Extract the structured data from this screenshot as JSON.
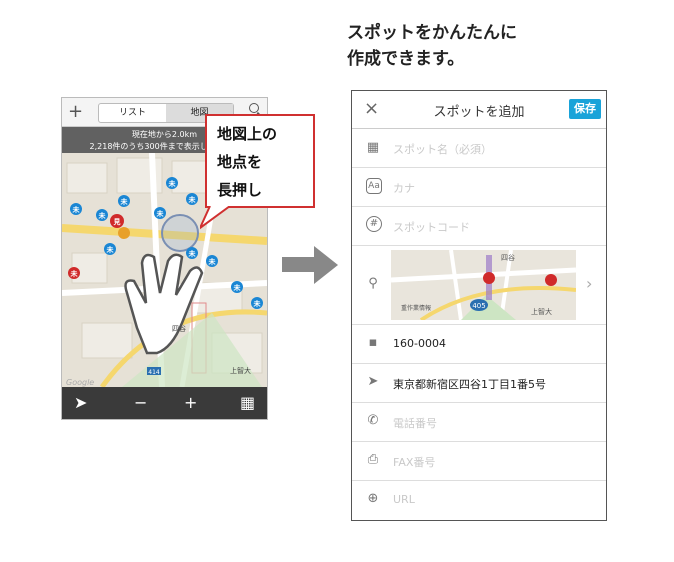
{
  "headline": {
    "line1": "スポットをかんたんに",
    "line2": "作成できます。"
  },
  "phone_map": {
    "add_label": "+",
    "tabs": [
      {
        "label": "リスト",
        "active": false
      },
      {
        "label": "地図",
        "active": true
      }
    ],
    "banner": {
      "line1": "現在地から2.0km",
      "line2": "2,218件のうち300件まで表示しています"
    },
    "map_labels": {
      "yotsuya": "四谷",
      "kamichi": "上智大",
      "toolbar_minus": "−",
      "toolbar_plus": "+",
      "logo": "Google",
      "road_tag": "414"
    },
    "toolbar_icons": [
      "location-arrow-icon",
      "zoom-out-icon",
      "zoom-in-icon",
      "list-icon"
    ]
  },
  "callout": {
    "line1": "地図上の",
    "line2": "地点を",
    "line3": "長押し"
  },
  "form": {
    "close_label": "×",
    "title": "スポットを追加",
    "save_label": "保存",
    "fields": {
      "spot_name": "スポット名（必須）",
      "kana": "カナ",
      "spot_code": "スポットコード",
      "postal_code": "160-0004",
      "address": "東京都新宿区四谷1丁目1番5号",
      "phone": "電話番号",
      "fax": "FAX番号",
      "url": "URL"
    },
    "map_thumb": {
      "area_label": "四谷",
      "road_number": "405",
      "place_label": "上智大",
      "business_label": "重作業情報"
    }
  },
  "colors": {
    "callout_border": "#d03030",
    "save_button": "#1aa3d9",
    "arrow": "#888888",
    "pin_blue": "#1a86d4",
    "pin_red": "#d02a2a"
  }
}
